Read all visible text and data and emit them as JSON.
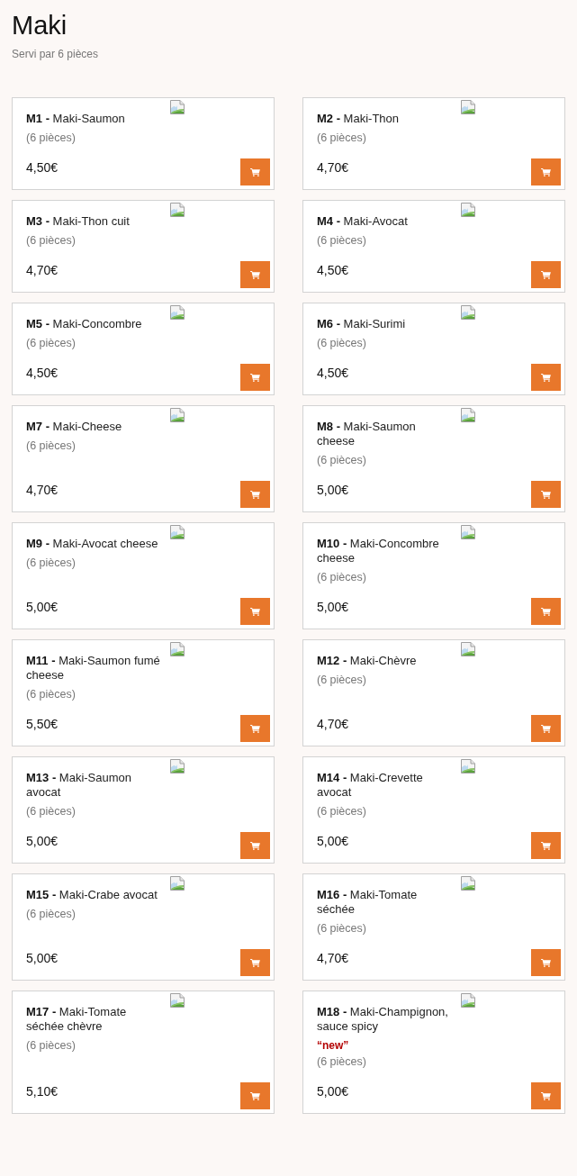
{
  "header": {
    "title": "Maki",
    "subtitle": "Servi par 6 pièces"
  },
  "items": [
    {
      "title": "**M1 -** Maki-Saumon",
      "portion": "(6 pièces)",
      "price": "4,50€"
    },
    {
      "title": "**M2 -** Maki-Thon",
      "portion": "(6 pièces)",
      "price": "4,70€"
    },
    {
      "title": "**M3 -** Maki-Thon cuit",
      "portion": "(6 pièces)",
      "price": "4,70€"
    },
    {
      "title": "**M4 -** Maki-Avocat",
      "portion": "(6 pièces)",
      "price": "4,50€"
    },
    {
      "title": "**M5 -** Maki-Concombre",
      "portion": "(6 pièces)",
      "price": "4,50€"
    },
    {
      "title": "**M6 -** Maki-Surimi",
      "portion": "(6 pièces)",
      "price": "4,50€"
    },
    {
      "title": "**M7 -** Maki-Cheese",
      "portion": "(6 pièces)",
      "price": "4,70€"
    },
    {
      "title": "**M8 -** Maki-Saumon cheese",
      "portion": "(6 pièces)",
      "price": "5,00€"
    },
    {
      "title": "**M9 -** Maki-Avocat cheese",
      "portion": "(6 pièces)",
      "price": "5,00€"
    },
    {
      "title": "**M10 -** Maki-Concombre cheese",
      "portion": "(6 pièces)",
      "price": "5,00€"
    },
    {
      "title": "**M11 -** Maki-Saumon fumé cheese",
      "portion": "(6 pièces)",
      "price": "5,50€"
    },
    {
      "title": "**M12 -** Maki-Chèvre",
      "portion": "(6 pièces)",
      "price": "4,70€"
    },
    {
      "title": "**M13 -** Maki-Saumon avocat",
      "portion": "(6 pièces)",
      "price": "5,00€"
    },
    {
      "title": "**M14 -** Maki-Crevette avocat",
      "portion": "(6 pièces)",
      "price": "5,00€"
    },
    {
      "title": "**M15 -** Maki-Crabe avocat",
      "portion": "(6 pièces)",
      "price": "5,00€"
    },
    {
      "title": "**M16 -** Maki-Tomate séchée",
      "portion": "(6 pièces)",
      "price": "4,70€"
    },
    {
      "title": "**M17 -** Maki-Tomate séchée chèvre",
      "portion": "(6 pièces)",
      "price": "5,10€"
    },
    {
      "title": "**M18 -** Maki-Champignon, sauce spicy",
      "badge": "“new”",
      "portion": "(6 pièces)",
      "price": "5,00€"
    }
  ]
}
